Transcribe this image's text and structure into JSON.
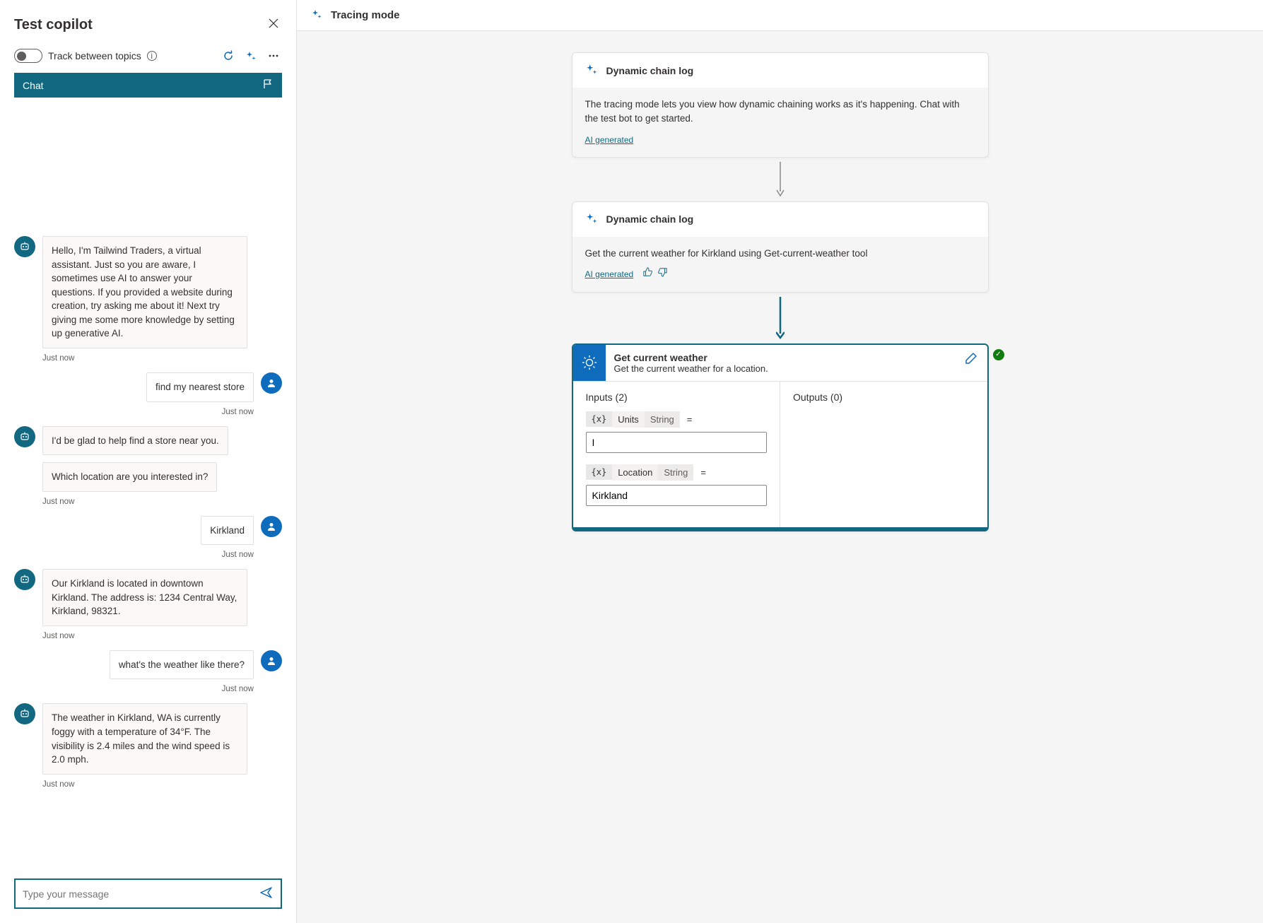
{
  "sidebar": {
    "title": "Test copilot",
    "track_label": "Track between topics",
    "chat_tab": "Chat"
  },
  "chat": {
    "messages": {
      "m0": "Hello, I'm Tailwind Traders, a virtual assistant. Just so you are aware, I sometimes use AI to answer your questions. If you provided a website during creation, try asking me about it! Next try giving me some more knowledge by setting up generative AI.",
      "t0": "Just now",
      "m1": "find my nearest store",
      "t1": "Just now",
      "m2": "I'd be glad to help find a store near you.",
      "m3": "Which location are you interested in?",
      "t3": "Just now",
      "m4": "Kirkland",
      "t4": "Just now",
      "m5": "Our Kirkland is located in downtown Kirkland. The address is: 1234 Central Way, Kirkland, 98321.",
      "t5": "Just now",
      "m6": "what's the weather like there?",
      "t6": "Just now",
      "m7": "The weather in Kirkland, WA is currently foggy with a temperature of 34°F. The visibility is 2.4 miles and the wind speed is 2.0 mph.",
      "t7": "Just now"
    },
    "input_placeholder": "Type your message"
  },
  "main": {
    "title": "Tracing mode",
    "node1": {
      "title": "Dynamic chain log",
      "body": "The tracing mode lets you view how dynamic chaining works as it's happening. Chat with the test bot to get started.",
      "ai": "AI generated"
    },
    "node2": {
      "title": "Dynamic chain log",
      "body": "Get the current weather for Kirkland using Get-current-weather tool",
      "ai": "AI generated"
    },
    "tool": {
      "title": "Get current weather",
      "subtitle": "Get the current weather for a location.",
      "inputs_title": "Inputs (2)",
      "outputs_title": "Outputs (0)",
      "p1": {
        "name": "Units",
        "type": "String",
        "value": "I"
      },
      "p2": {
        "name": "Location",
        "type": "String",
        "value": "Kirkland"
      }
    }
  }
}
